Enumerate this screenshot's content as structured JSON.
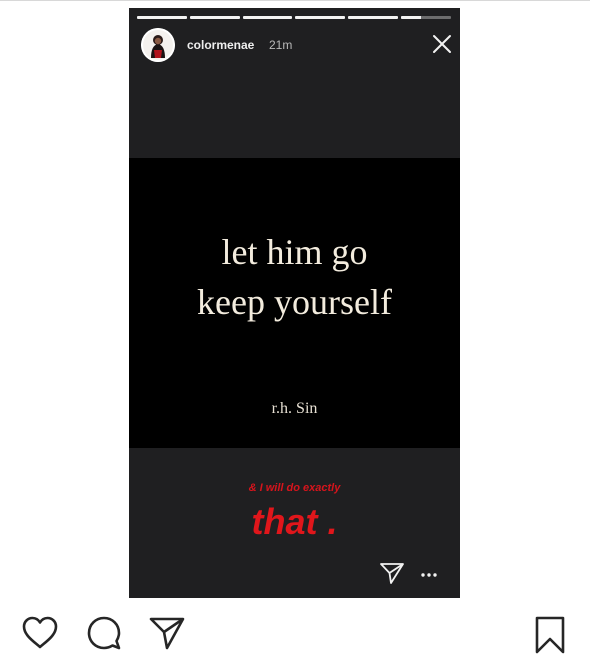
{
  "story": {
    "username": "colormenae",
    "time": "21m",
    "progress_segments": [
      1,
      1,
      1,
      1,
      1,
      0.4
    ],
    "quote": {
      "line1": "let him go",
      "line2": "keep yourself",
      "author": "r.h. Sin"
    },
    "caption_small": "& I will do exactly",
    "caption_big": "that .",
    "colors": {
      "caption": "#e0161b",
      "story_background": "#1f1f21",
      "quote_background": "#000000"
    }
  },
  "actions": {
    "icons": [
      "heart-icon",
      "comment-icon",
      "share-icon",
      "bookmark-icon"
    ]
  }
}
